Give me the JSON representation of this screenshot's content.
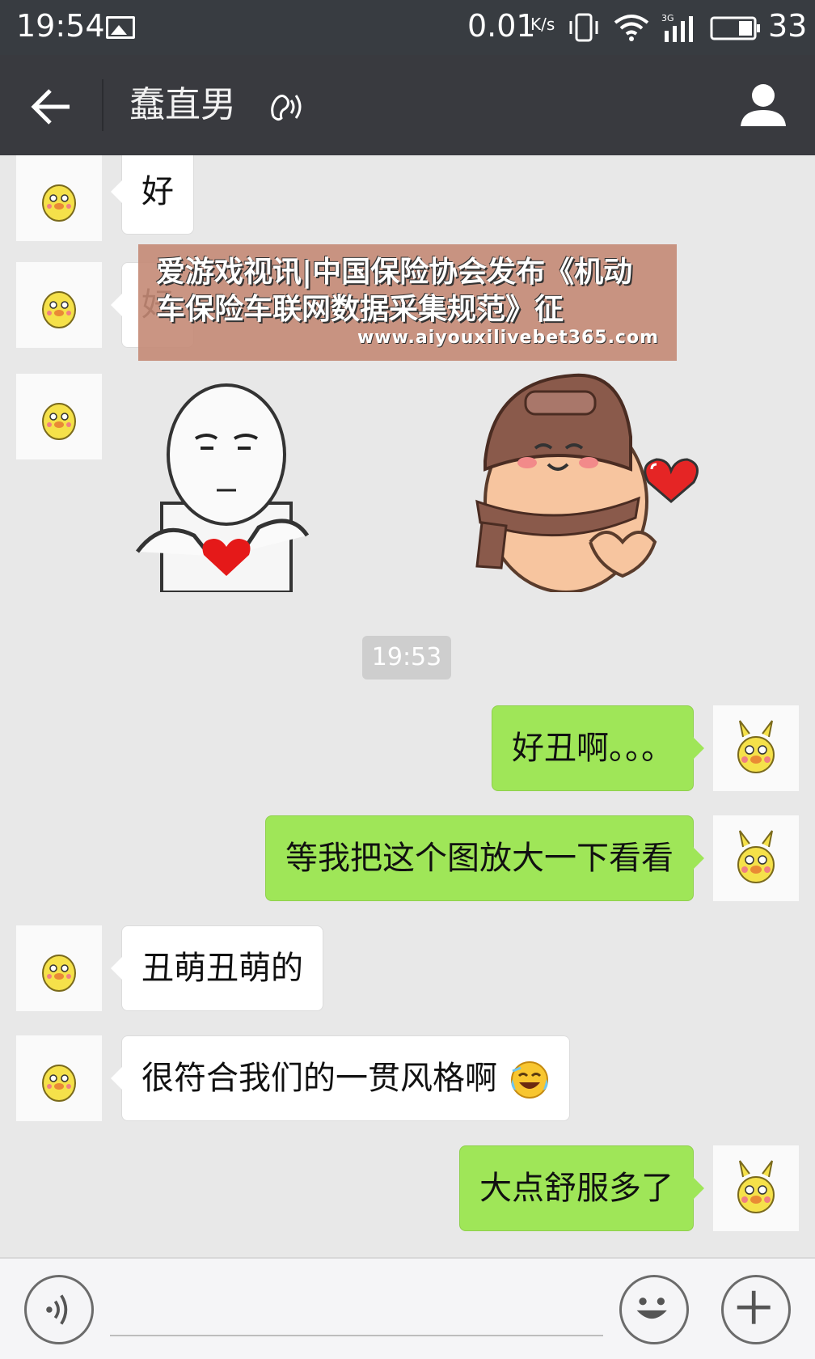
{
  "status_bar": {
    "time": "19:54",
    "net_speed": "0.01",
    "net_unit": "K/s",
    "network_type": "3G",
    "battery": "33",
    "icons": [
      "image-icon",
      "vibrate-icon",
      "wifi-icon",
      "signal-icon",
      "battery-icon"
    ]
  },
  "header": {
    "title": "蠢直男",
    "icons": [
      "back-arrow-icon",
      "earpiece-mode-icon",
      "profile-icon"
    ]
  },
  "watermark": {
    "text": "爱游戏视讯|中国保险协会发布《机动车保险车联网数据采集规范》征",
    "url": "www.aiyouxilivebet365.com"
  },
  "messages": [
    {
      "side": "left",
      "type": "text",
      "text": "好"
    },
    {
      "side": "left",
      "type": "text",
      "text": "好"
    },
    {
      "side": "left",
      "type": "sticker",
      "sticker": "meme-face-heart-sticker"
    },
    {
      "side": "left",
      "type": "sticker",
      "sticker": "beanie-heart-hands-sticker"
    },
    {
      "side": "right",
      "type": "text",
      "text": "好丑啊。。。"
    },
    {
      "side": "right",
      "type": "text",
      "text": "等我把这个图放大一下看看"
    },
    {
      "side": "left",
      "type": "text",
      "text": "丑萌丑萌的"
    },
    {
      "side": "left",
      "type": "text",
      "text": "很符合我们的一贯风格啊",
      "emoji": "laughing-crying-emoji"
    },
    {
      "side": "right",
      "type": "text",
      "text": "大点舒服多了"
    }
  ],
  "timestamp": "19:53",
  "input_bar": {
    "placeholder": "",
    "icons": [
      "voice-icon",
      "emoji-icon",
      "plus-icon"
    ]
  },
  "colors": {
    "status_bar_bg": "#383c41",
    "header_bg": "#393a3f",
    "chat_bg": "#e8e8e8",
    "bubble_right": "#9fe658",
    "bubble_left": "#ffffff",
    "watermark_bg": "#c48976"
  }
}
